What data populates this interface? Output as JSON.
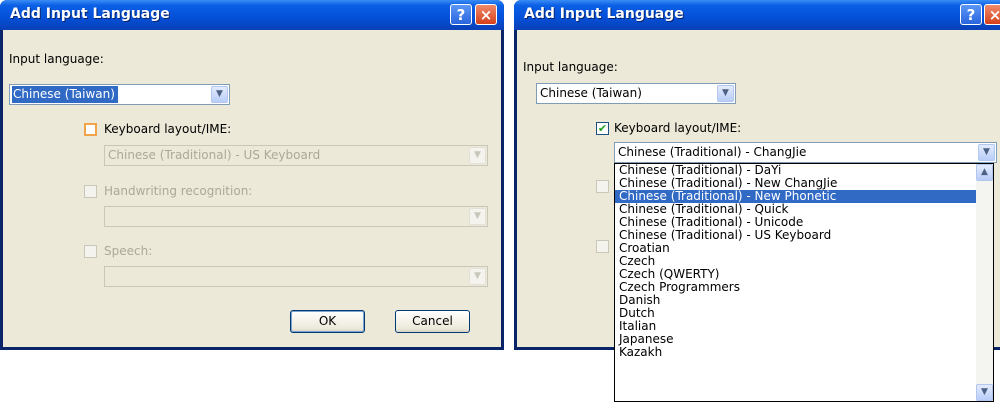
{
  "colors": {
    "titlebar": "#0450d8",
    "dialog_bg": "#ece9d8",
    "selection": "#316ac5",
    "disabled_text": "#aca899"
  },
  "dialog_left": {
    "title": "Add Input Language",
    "help_icon": "?",
    "close_icon": "×",
    "input_language_label": "Input language:",
    "input_language_value": "Chinese (Taiwan)",
    "keyboard_label": "Keyboard layout/IME:",
    "keyboard_value": "Chinese (Traditional) - US Keyboard",
    "handwriting_label": "Handwriting recognition:",
    "speech_label": "Speech:",
    "ok_label": "OK",
    "cancel_label": "Cancel"
  },
  "dialog_right": {
    "title": "Add Input Language",
    "help_icon": "?",
    "close_icon": "×",
    "input_language_label": "Input language:",
    "input_language_value": "Chinese (Taiwan)",
    "keyboard_label": "Keyboard layout/IME:",
    "keyboard_value": "Chinese (Traditional) - ChangJie",
    "keyboard_checked": "✔",
    "dropdown_items": [
      "Chinese (Traditional) - DaYi",
      "Chinese (Traditional) - New ChangJie",
      "Chinese (Traditional) - New Phonetic",
      "Chinese (Traditional) - Quick",
      "Chinese (Traditional) - Unicode",
      "Chinese (Traditional) - US Keyboard",
      "Croatian",
      "Czech",
      "Czech (QWERTY)",
      "Czech Programmers",
      "Danish",
      "Dutch",
      "Italian",
      "Japanese",
      "Kazakh"
    ],
    "highlighted_item": "Chinese (Traditional) - New Phonetic"
  },
  "icons": {
    "chevron_down": "✔",
    "chevron_up": "✔"
  }
}
